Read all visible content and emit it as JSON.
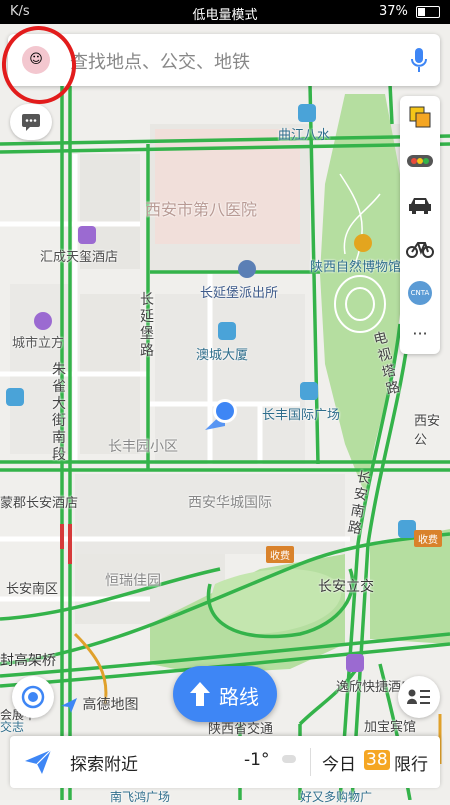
{
  "status_bar": {
    "left": "K/s",
    "center": "低电量模式",
    "battery": "37%",
    "battery_level": 0.37
  },
  "search": {
    "placeholder": "查找地点、公交、地铁"
  },
  "map_labels": {
    "qujiang": "曲江八水",
    "xian_eighth_hospital": "西安市第八医院",
    "huicheng_hotel": "汇成天玺酒店",
    "changyanbao_police": "长延堡派出所",
    "shaanxi_museum": "陕西自然博物馆",
    "chengshi_lifang": "城市立方",
    "aocheng_dasha": "澳城大厦",
    "changfeng_plaza": "长丰国际广场",
    "changfengyuan": "长丰园小区",
    "xian_huacheng": "西安华城国际",
    "hengrui_jiayuan": "恒瑞佳园",
    "changan_lijiao": "长安立交",
    "nanjun_hotel": "蒙郡长安酒店",
    "changan_nanqu": "长安南区",
    "gaojiaqiao": "封高架桥",
    "yipin_hotel": "逸欣快捷酒店",
    "shaanxi_jiaotong": "陕西省交通",
    "jiaxing_hotel": "加宝宾馆",
    "haoyou_plaza": "好又多购物广",
    "nanfei_plaza": "南飞鸿广场",
    "xian_right": "西安公",
    "exhibition": "会展中",
    "jiaozhi": "交志",
    "fee1": "收费",
    "fee2": "收费"
  },
  "road_labels": {
    "changyanbao_road": "长延堡路",
    "zhuque_street_south": "朱雀大街南段",
    "tv_tower_road": "电视塔路",
    "changan_south_road": "长安南路"
  },
  "tools": {
    "layers": "layers-icon",
    "traffic": "traffic-light-icon",
    "taxi": "taxi-icon",
    "bike": "bike-icon",
    "cnta": "CNTA",
    "more": "···"
  },
  "controls": {
    "route_label": "路线",
    "brand": "高德地图"
  },
  "bottom_bar": {
    "explore": "探索附近",
    "temperature": "-1°",
    "today_label": "今日",
    "restrict_numbers": "38",
    "restrict_label": "限行"
  },
  "colors": {
    "road_green": "#34b34a",
    "route_blue": "#3e86f5",
    "park_green": "#b5dea0",
    "annotation_red": "#e21c1c"
  }
}
